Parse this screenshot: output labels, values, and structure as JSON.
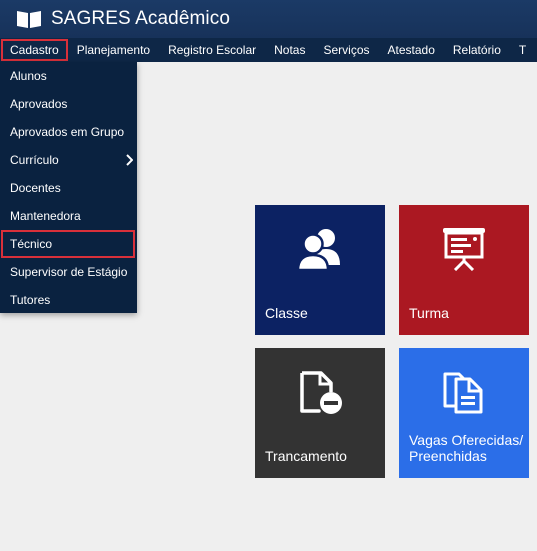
{
  "header": {
    "title": "SAGRES Acadêmico",
    "logo_icon": "open-book-icon",
    "background": "#17325a"
  },
  "menubar": {
    "items": [
      "Cadastro",
      "Planejamento",
      "Registro Escolar",
      "Notas",
      "Serviços",
      "Atestado",
      "Relatório",
      "T"
    ],
    "active_index": 0
  },
  "dropdown": {
    "items": [
      "Alunos",
      "Aprovados",
      "Aprovados em Grupo",
      "Currículo",
      "Docentes",
      "Mantenedora",
      "Técnico",
      "Supervisor de Estágio",
      "Tutores"
    ],
    "highlighted": "Técnico",
    "submenu_item": "Currículo"
  },
  "tiles": [
    {
      "label": "Classe",
      "icon": "users-icon",
      "color": "#0c2263"
    },
    {
      "label": "Turma",
      "icon": "presentation-board-icon",
      "color": "#ab1822"
    },
    {
      "label": "Trancamento",
      "icon": "file-remove-icon",
      "color": "#333333"
    },
    {
      "label": "Vagas Oferecidas/ Preenchidas",
      "icon": "copy-document-icon",
      "color": "#2b6ee8"
    }
  ],
  "colors": {
    "highlight_border": "#d9303a",
    "page_background": "#efefef"
  }
}
